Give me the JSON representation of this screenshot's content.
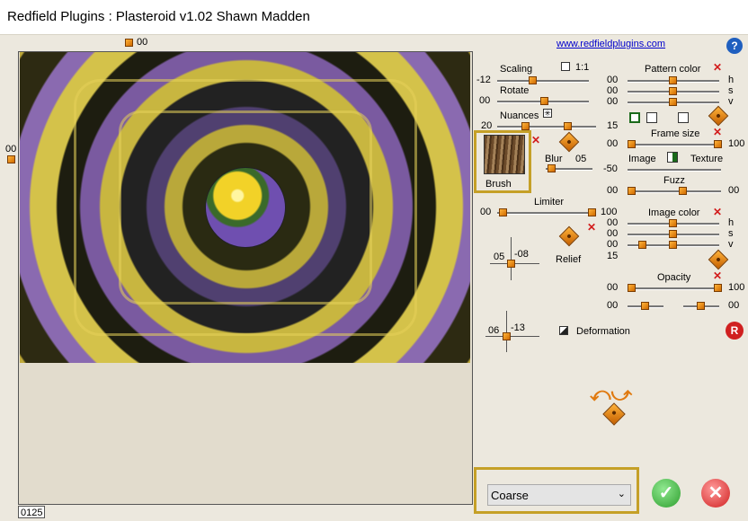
{
  "window": {
    "title": "Redfield Plugins : Plasteroid v1.02   Shawn Madden"
  },
  "canvas": {
    "top_value": "00",
    "left_value": "00",
    "zoom": "0125"
  },
  "header": {
    "link": "www.redfieldplugins.com",
    "help_icon": "help-icon"
  },
  "scaling": {
    "label": "Scaling",
    "check_label": "1:1",
    "value": "-12"
  },
  "rotate": {
    "label": "Rotate",
    "value": "00"
  },
  "nuances": {
    "label": "Nuances",
    "left_value": "20",
    "right_value": "15"
  },
  "brush": {
    "label": "Brush"
  },
  "blur": {
    "label": "Blur",
    "value": "05"
  },
  "limiter": {
    "label": "Limiter",
    "left_value": "00",
    "right_value": "100"
  },
  "relief": {
    "label": "Relief",
    "x_value": "05",
    "y_value": "-08"
  },
  "deformation": {
    "label": "Deformation",
    "x_value": "06",
    "y_value": "-13"
  },
  "pattern_color": {
    "label": "Pattern color",
    "h": "00",
    "s": "00",
    "v": "00",
    "h_label": "h",
    "s_label": "s",
    "v_label": "v"
  },
  "frame_size": {
    "label": "Frame size",
    "left_value": "00",
    "right_value": "100"
  },
  "image_texture": {
    "image_label": "Image",
    "texture_label": "Texture",
    "value": "-50"
  },
  "fuzz": {
    "label": "Fuzz",
    "left_value": "00",
    "right_value": "00"
  },
  "image_color": {
    "label": "Image color",
    "h": "00",
    "s": "00",
    "v": "00",
    "extra": "15",
    "h_label": "h",
    "s_label": "s",
    "v_label": "v"
  },
  "opacity": {
    "label": "Opacity",
    "left_value": "00",
    "right_value": "100",
    "row2_left": "00",
    "row2_right": "00"
  },
  "quality": {
    "selected": "Coarse"
  },
  "reset_label": "R",
  "colors": {
    "accent_gold": "#c5a027",
    "ok_green": "#2e9e2e",
    "cancel_red": "#d02020"
  }
}
